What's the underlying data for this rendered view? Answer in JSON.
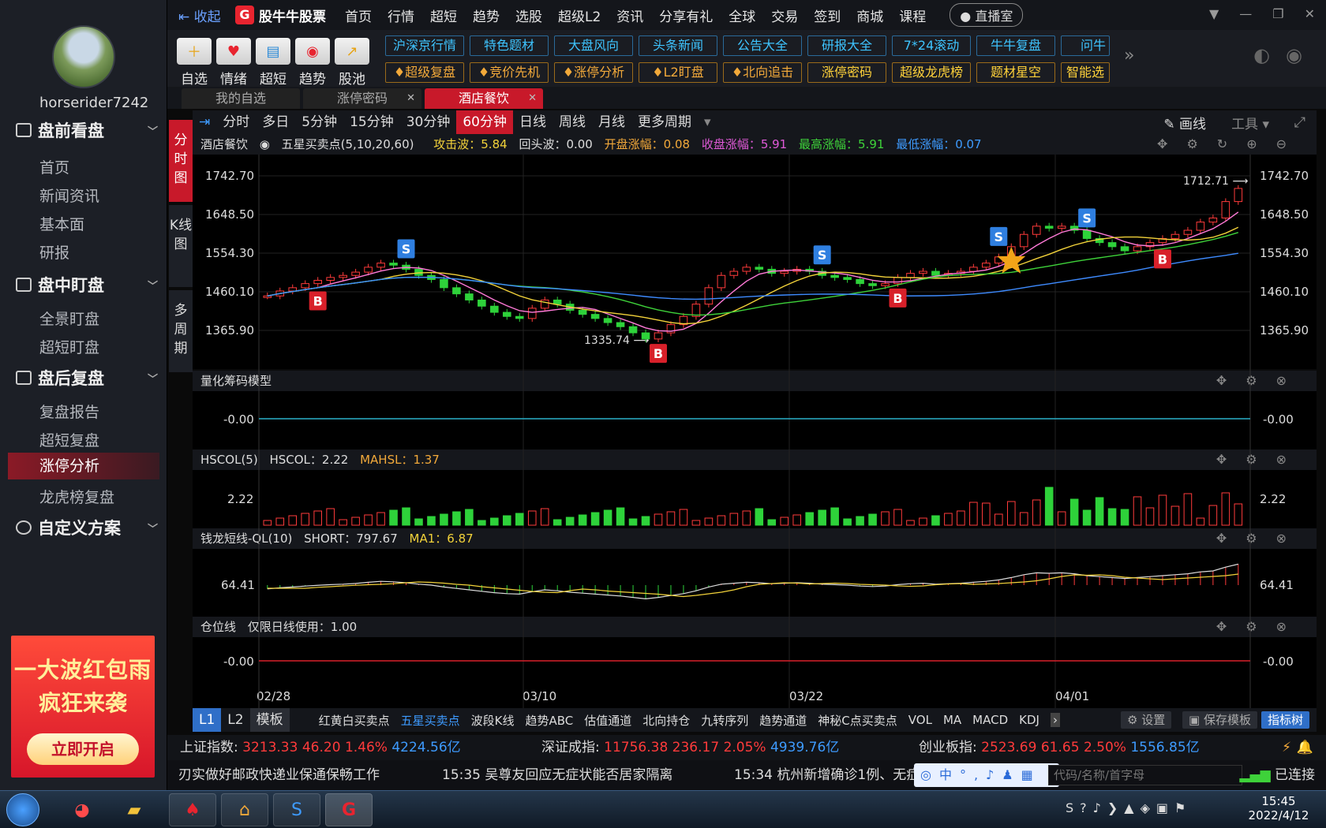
{
  "user": {
    "name": "horserider7242"
  },
  "sidebar": {
    "groups": [
      {
        "label": "盘前看盘",
        "items": [
          "首页",
          "新闻资讯",
          "基本面",
          "研报"
        ]
      },
      {
        "label": "盘中盯盘",
        "items": [
          "全景盯盘",
          "超短盯盘"
        ]
      },
      {
        "label": "盘后复盘",
        "items": [
          "复盘报告",
          "超短复盘",
          "涨停分析",
          "龙虎榜复盘"
        ]
      },
      {
        "label": "自定义方案",
        "items": []
      }
    ],
    "active_item": "涨停分析"
  },
  "ad": {
    "line1": "一大波红包雨",
    "line2": "疯狂来袭",
    "button": "立即开启"
  },
  "topbar": {
    "collapse": "收起",
    "app_name": "股牛牛股票",
    "menu": [
      "首页",
      "行情",
      "超短",
      "趋势",
      "选股",
      "超级L2",
      "资讯",
      "分享有礼",
      "全球",
      "交易",
      "签到",
      "商城",
      "课程"
    ],
    "live": "直播室"
  },
  "toolbar": {
    "tools": [
      {
        "label": "自选",
        "icon": "folder-plus-icon"
      },
      {
        "label": "情绪",
        "icon": "heart-icon"
      },
      {
        "label": "超短",
        "icon": "chart-folder-icon"
      },
      {
        "label": "趋势",
        "icon": "target-icon"
      },
      {
        "label": "股池",
        "icon": "trend-icon"
      }
    ],
    "quick_row1": [
      "沪深京行情",
      "特色题材",
      "大盘风向",
      "头条新闻",
      "公告大全",
      "研报大全",
      "7*24滚动",
      "牛牛复盘",
      "问牛"
    ],
    "quick_row2": [
      "超级复盘",
      "竞价先机",
      "涨停分析",
      "L2盯盘",
      "北向追击",
      "涨停密码",
      "超级龙虎榜",
      "题材星空",
      "智能选"
    ]
  },
  "tabs": [
    {
      "label": "我的自选"
    },
    {
      "label": "涨停密码"
    },
    {
      "label": "酒店餐饮"
    }
  ],
  "vtabs": [
    "分时图",
    "K线图",
    "多周期"
  ],
  "periods": [
    "分时",
    "多日",
    "5分钟",
    "15分钟",
    "30分钟",
    "60分钟",
    "日线",
    "周线",
    "月线",
    "更多周期"
  ],
  "active_period": "60分钟",
  "draw_label": "画线",
  "tool_label": "工具",
  "main": {
    "name": "酒店餐饮",
    "indicator": "五星买卖点(5,10,20,60)",
    "stats": [
      {
        "label": "攻击波：5.84",
        "color": "#f2d23a"
      },
      {
        "label": "回头波：0.00",
        "color": "#dddddd"
      },
      {
        "label": "开盘涨幅：0.08",
        "color": "#f2a93a"
      },
      {
        "label": "收盘涨幅：5.91",
        "color": "#e05ad8"
      },
      {
        "label": "最高涨幅：5.91",
        "color": "#3ed23a"
      },
      {
        "label": "最低涨幅：0.07",
        "color": "#3e9bff"
      }
    ],
    "y_labels": [
      "1742.70",
      "1648.50",
      "1554.30",
      "1460.10",
      "1365.90"
    ],
    "high_label": "1712.71",
    "low_label": "1335.74",
    "x_labels": [
      "02/28",
      "03/10",
      "03/22",
      "04/01"
    ]
  },
  "p2": {
    "title": "量化筹码模型",
    "value": "-0.00"
  },
  "p3": {
    "title": "HSCOL(5)",
    "s1": "HSCOL：2.22",
    "s2": "MAHSL：1.37",
    "value": "2.22"
  },
  "p4": {
    "title": "钱龙短线-QL(10)",
    "s1": "SHORT：797.67",
    "s2": "MA1：6.87",
    "value": "64.41"
  },
  "p5": {
    "title": "仓位线",
    "s1": "仅限日线使用：1.00",
    "value": "-0.00"
  },
  "indbar": {
    "levels": [
      "L1",
      "L2",
      "模板"
    ],
    "indicators": [
      "红黄白买卖点",
      "五星买卖点",
      "波段K线",
      "趋势ABC",
      "估值通道",
      "北向持仓",
      "九转序列",
      "趋势通道",
      "神秘C点买卖点",
      "VOL",
      "MA",
      "MACD",
      "KDJ"
    ],
    "active_indicator": "五星买卖点",
    "settings": "设置",
    "save": "保存模板",
    "tree": "指标树"
  },
  "indexbar": {
    "sh": {
      "name": "上证指数:",
      "v": "3213.33",
      "c": "46.20",
      "p": "1.46%",
      "a": "4224.56亿"
    },
    "sz": {
      "name": "深证成指:",
      "v": "11756.38",
      "c": "236.17",
      "p": "2.05%",
      "a": "4939.76亿"
    },
    "cy": {
      "name": "创业板指:",
      "v": "2523.69",
      "c": "61.65",
      "p": "2.50%",
      "a": "1556.85亿"
    }
  },
  "news": [
    "刃实做好邮政快递业保通保畅工作",
    "15:35 吴尊友回应无症状能否居家隔离",
    "15:34 杭州新增确诊1例、无症"
  ],
  "search_placeholder": "代码/名称/首字母",
  "connected": "已连接",
  "clock": {
    "time": "15:45",
    "date": "2022/4/12"
  },
  "chart_data": {
    "type": "candlestick",
    "y_ticks": [
      1742.7,
      1648.5,
      1554.3,
      1460.1,
      1365.9
    ],
    "x_ticks": [
      "02/28",
      "03/10",
      "03/22",
      "04/01"
    ],
    "closes": [
      1450,
      1462,
      1470,
      1480,
      1488,
      1495,
      1500,
      1508,
      1520,
      1530,
      1525,
      1515,
      1500,
      1490,
      1470,
      1455,
      1440,
      1425,
      1410,
      1400,
      1395,
      1420,
      1440,
      1430,
      1415,
      1405,
      1395,
      1385,
      1375,
      1360,
      1345,
      1360,
      1380,
      1400,
      1430,
      1470,
      1500,
      1510,
      1520,
      1515,
      1505,
      1510,
      1515,
      1510,
      1500,
      1495,
      1490,
      1480,
      1475,
      1480,
      1495,
      1505,
      1510,
      1500,
      1505,
      1510,
      1520,
      1530,
      1545,
      1570,
      1600,
      1620,
      1615,
      1620,
      1610,
      1590,
      1580,
      1570,
      1560,
      1570,
      1580,
      1590,
      1600,
      1610,
      1630,
      1640,
      1680,
      1712
    ]
  }
}
